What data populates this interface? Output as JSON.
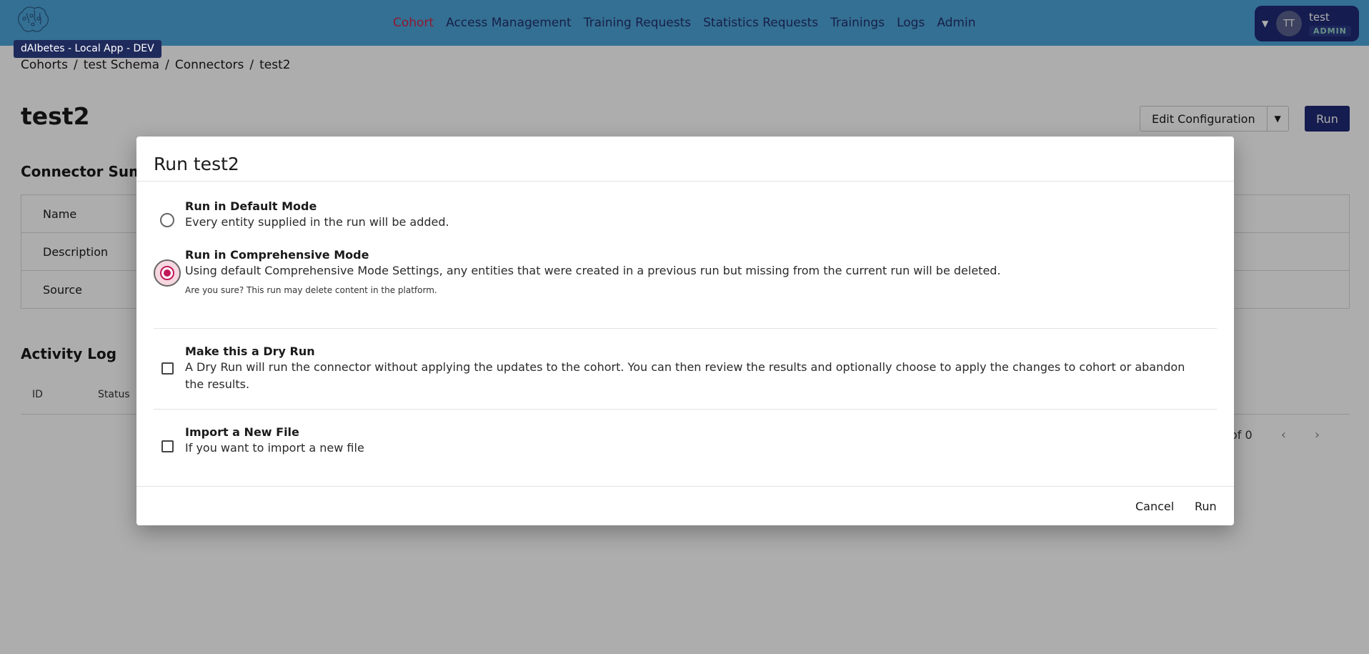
{
  "app": {
    "env_tag": "dAIbetes - Local App - DEV"
  },
  "nav": {
    "items": [
      {
        "label": "Cohort",
        "active": true
      },
      {
        "label": "Access Management"
      },
      {
        "label": "Training Requests"
      },
      {
        "label": "Statistics Requests"
      },
      {
        "label": "Trainings"
      },
      {
        "label": "Logs"
      },
      {
        "label": "Admin"
      }
    ]
  },
  "user": {
    "initials": "TT",
    "name": "test",
    "role": "ADMIN"
  },
  "breadcrumb": {
    "items": [
      "Cohorts",
      "test Schema",
      "Connectors",
      "test2"
    ],
    "separator": "/"
  },
  "page": {
    "title": "test2",
    "edit_button": "Edit Configuration",
    "run_button": "Run"
  },
  "summary": {
    "title": "Connector Summary",
    "rows": [
      "Name",
      "Description",
      "Source"
    ]
  },
  "activity": {
    "title": "Activity Log",
    "columns": [
      "ID",
      "Status"
    ],
    "pager_text": "of 0"
  },
  "dialog": {
    "title": "Run test2",
    "options": {
      "default": {
        "title": "Run in Default Mode",
        "description": "Every entity supplied in the run will be added."
      },
      "comprehensive": {
        "title": "Run in Comprehensive Mode",
        "description": "Using default Comprehensive Mode Settings, any entities that were created in a previous run but missing from the current run will be deleted.",
        "warning": "Are you sure? This run may delete content in the platform."
      },
      "dry_run": {
        "title": "Make this a Dry Run",
        "description": "A Dry Run will run the connector without applying the updates to the cohort. You can then review the results and optionally choose to apply the changes to cohort or abandon the results."
      },
      "import_file": {
        "title": "Import a New File",
        "description": "If you want to import a new file"
      }
    },
    "cancel_label": "Cancel",
    "run_label": "Run"
  },
  "colors": {
    "header_bg": "#4da6d9",
    "nav_text": "#23306b",
    "nav_active": "#d3254a",
    "primary": "#1f2a75",
    "radio_selected": "#c2185b"
  }
}
